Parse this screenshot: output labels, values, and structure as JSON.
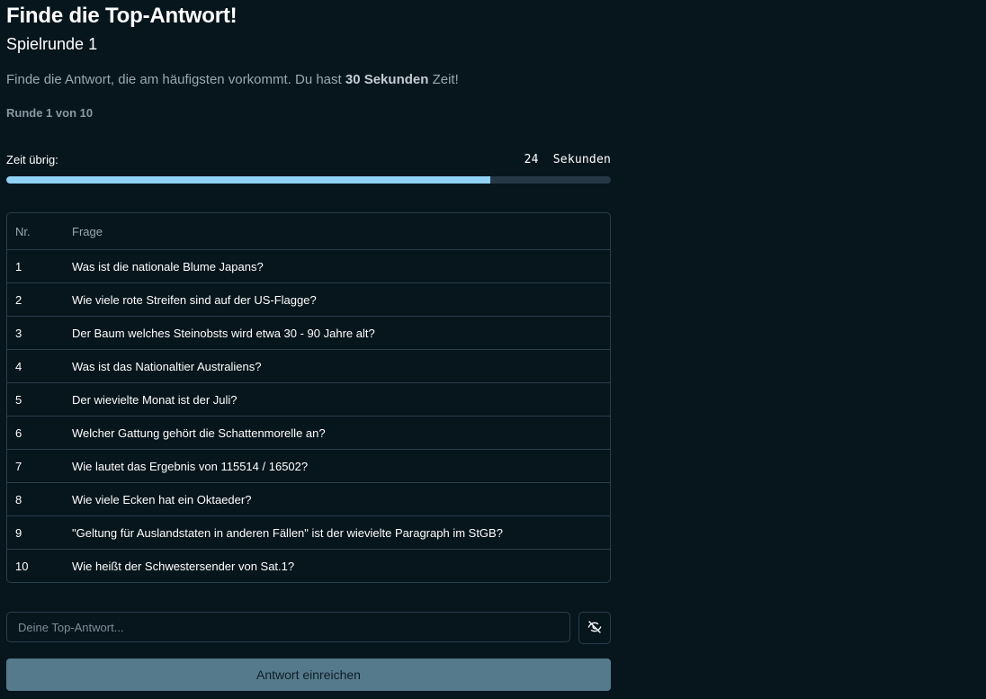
{
  "header": {
    "title": "Finde die Top-Antwort!",
    "subtitle": "Spielrunde 1"
  },
  "description": {
    "before": "Finde die Antwort, die am häufigsten vorkommt. Du hast ",
    "bold": "30 Sekunden",
    "after": " Zeit!"
  },
  "round_info": "Runde 1 von 10",
  "timer": {
    "label": "Zeit übrig:",
    "value": "24",
    "unit": "Sekunden",
    "progress_fraction": 0.8
  },
  "table": {
    "headers": [
      "Nr.",
      "Frage"
    ],
    "rows": [
      {
        "nr": "1",
        "frage": "Was ist die nationale Blume Japans?"
      },
      {
        "nr": "2",
        "frage": "Wie viele rote Streifen sind auf der US-Flagge?"
      },
      {
        "nr": "3",
        "frage": "Der Baum welches Steinobsts wird etwa 30 - 90 Jahre alt?"
      },
      {
        "nr": "4",
        "frage": "Was ist das Nationaltier Australiens?"
      },
      {
        "nr": "5",
        "frage": "Der wievielte Monat ist der Juli?"
      },
      {
        "nr": "6",
        "frage": "Welcher Gattung gehört die Schattenmorelle an?"
      },
      {
        "nr": "7",
        "frage": "Wie lautet das Ergebnis von 115514 / 16502?"
      },
      {
        "nr": "8",
        "frage": "Wie viele Ecken hat ein Oktaeder?"
      },
      {
        "nr": "9",
        "frage": "\"Geltung für Auslandstaten in anderen Fällen\" ist der wievielte Paragraph im StGB?"
      },
      {
        "nr": "10",
        "frage": "Wie heißt der Schwestersender von Sat.1?"
      }
    ]
  },
  "answer": {
    "placeholder": "Deine Top-Antwort...",
    "value": "",
    "toggle_icon": "eye-off-icon",
    "submit_label": "Antwort einreichen"
  },
  "colors": {
    "background": "#07151d",
    "progress_fill": "#90d3f6",
    "progress_track": "#243845",
    "submit_button": "#557a8c"
  }
}
